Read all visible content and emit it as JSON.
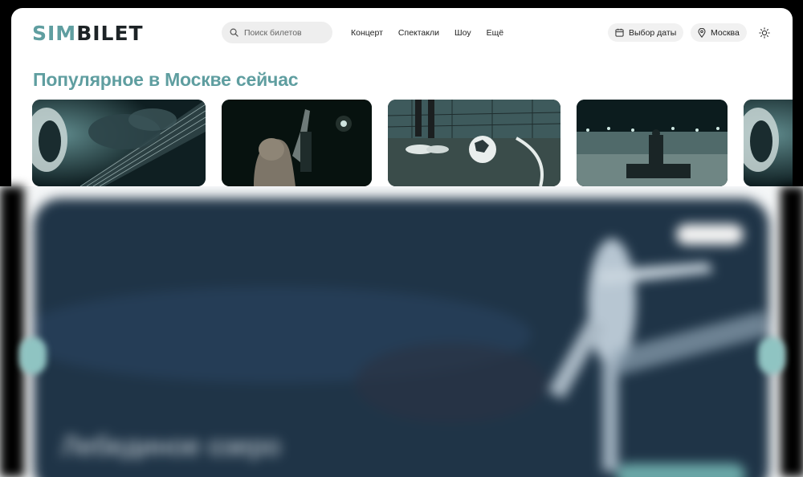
{
  "header": {
    "logo": {
      "part1": "SIM",
      "part2": "BILET"
    },
    "search": {
      "placeholder": "Поиск билетов",
      "value": ""
    },
    "nav": [
      {
        "label": "Концерт"
      },
      {
        "label": "Спектакли"
      },
      {
        "label": "Шоу"
      },
      {
        "label": "Ещё"
      }
    ],
    "date_button": {
      "label": "Выбор даты",
      "icon": "calendar-icon"
    },
    "city_button": {
      "label": "Москва",
      "icon": "location-pin-icon"
    },
    "theme_toggle": {
      "icon": "sun-icon"
    }
  },
  "popular": {
    "title": "Популярное в Москве сейчас",
    "cards": [
      {
        "subject": "bass guitar"
      },
      {
        "subject": "concert crowd"
      },
      {
        "subject": "football"
      },
      {
        "subject": "outdoor stage"
      },
      {
        "subject": "bass guitar"
      }
    ]
  },
  "hero": {
    "meta": "",
    "title": "Лебединое озеро"
  },
  "colors": {
    "accent": "#5f9ea0",
    "logo_dark": "#1d2326",
    "hero_bg": "#1f3447"
  }
}
